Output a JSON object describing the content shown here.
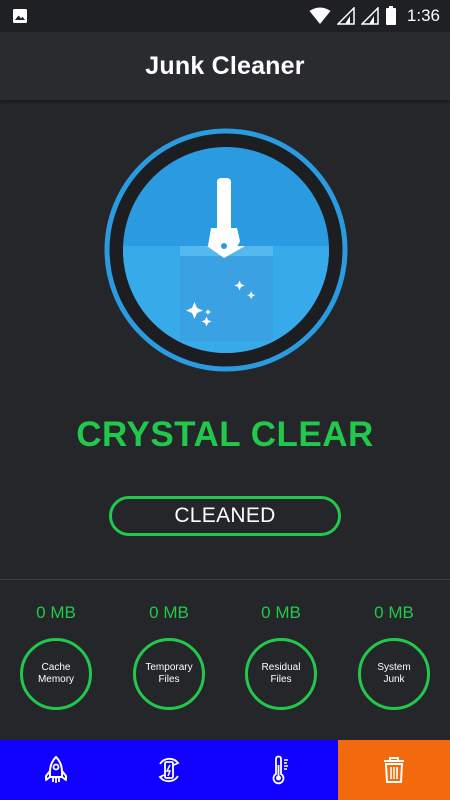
{
  "status_bar": {
    "time": "1:36",
    "icons": [
      "gallery-icon",
      "wifi-icon",
      "signal-icon",
      "signal-icon",
      "battery-icon"
    ]
  },
  "app": {
    "title": "Junk Cleaner"
  },
  "hero": {
    "icon": "broom-in-glass-icon",
    "status": "CRYSTAL CLEAR",
    "button_label": "CLEANED"
  },
  "stats": [
    {
      "value": "0 MB",
      "label": "Cache\nMemory"
    },
    {
      "value": "0 MB",
      "label": "Temporary\nFiles"
    },
    {
      "value": "0 MB",
      "label": "Residual\nFiles"
    },
    {
      "value": "0 MB",
      "label": "System\nJunk"
    }
  ],
  "bottom_nav": [
    {
      "icon": "rocket-icon"
    },
    {
      "icon": "battery-saver-icon"
    },
    {
      "icon": "thermometer-icon"
    },
    {
      "icon": "trash-icon",
      "active": true
    }
  ],
  "colors": {
    "accent": "#22c84b",
    "hero_blue": "#2b9be1",
    "nav_blue": "#1000ff",
    "nav_active": "#f26a0d",
    "background": "#25262a"
  }
}
